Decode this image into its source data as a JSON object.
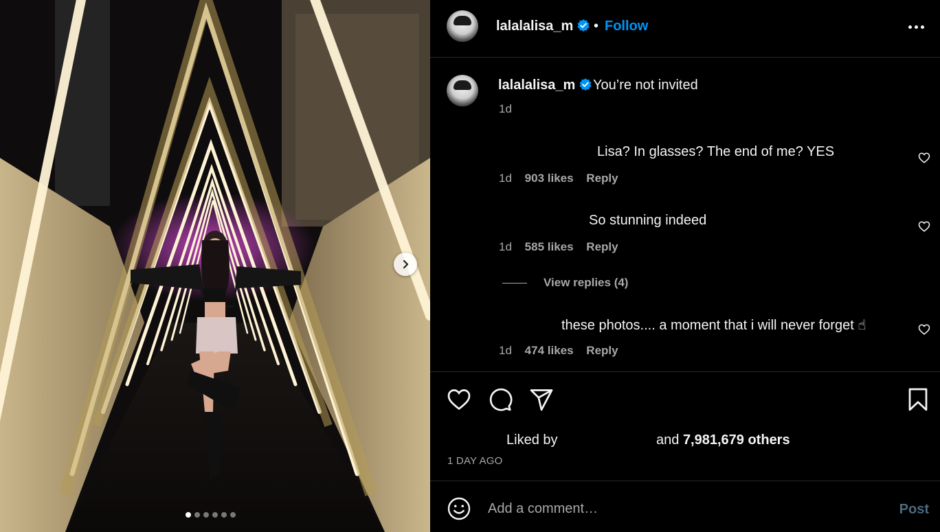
{
  "post": {
    "username": "lalalalisa_m",
    "separator": "•",
    "follow_label": "Follow",
    "caption": "You’re not invited",
    "caption_time": "1d",
    "carousel": {
      "slides": 6,
      "current": 1
    }
  },
  "comments": [
    {
      "text": "Lisa? In glasses? The end of me? YES",
      "time": "1d",
      "likes": "903 likes",
      "reply_label": "Reply"
    },
    {
      "text": "So stunning indeed",
      "time": "1d",
      "likes": "585 likes",
      "reply_label": "Reply"
    },
    {
      "text": "these photos.... a moment that i will never forget ☝",
      "time": "1d",
      "likes": "474 likes",
      "reply_label": "Reply"
    }
  ],
  "view_replies_label": "View replies (4)",
  "likes_summary": {
    "liked_by": "Liked by",
    "and": "and",
    "count": "7,981,679 others"
  },
  "posted_ago": "1 DAY AGO",
  "add_comment": {
    "placeholder": "Add a comment…",
    "post_label": "Post"
  },
  "icons": {
    "verified": "verified-badge-icon",
    "more": "more-options-icon",
    "like": "heart-icon",
    "comment": "comment-icon",
    "share": "share-icon",
    "save": "bookmark-icon",
    "emoji": "emoji-icon",
    "next": "chevron-right-icon"
  },
  "colors": {
    "accent": "#0095f6",
    "verified": "#0095f6",
    "muted": "#a8a8a8",
    "post_disabled": "#4d6a80"
  }
}
